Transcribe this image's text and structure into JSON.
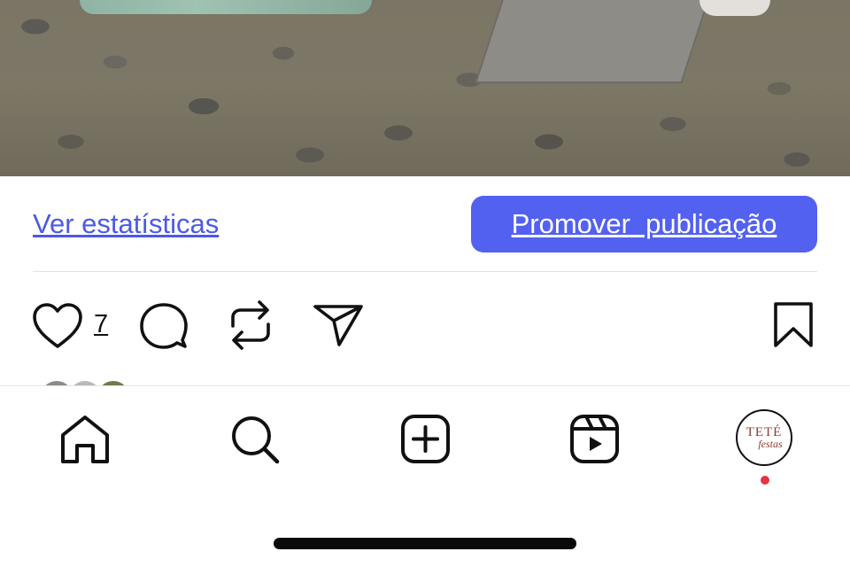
{
  "post": {
    "stats_link": "Ver estatísticas",
    "promote_button": "Promover  publicação",
    "like_count": "7"
  },
  "actions": {
    "icons": [
      "heart-icon",
      "comment-icon",
      "repost-icon",
      "share-icon",
      "bookmark-icon"
    ]
  },
  "nav": {
    "items": [
      "home-icon",
      "search-icon",
      "create-icon",
      "reels-icon",
      "profile-avatar"
    ],
    "profile_logo_line1": "TETÉ",
    "profile_logo_line2": "festas",
    "notification_color": "#e8323f"
  },
  "colors": {
    "accent": "#5361f1",
    "link": "#4b59e8"
  }
}
